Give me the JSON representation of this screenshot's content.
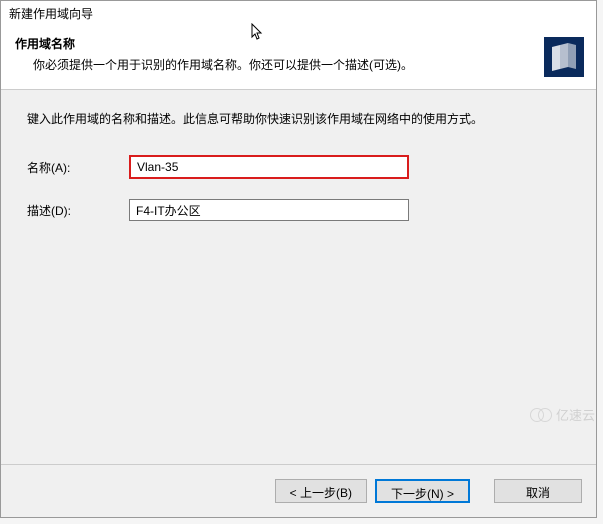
{
  "window": {
    "title": "新建作用域向导"
  },
  "header": {
    "title": "作用域名称",
    "subtitle": "你必须提供一个用于识别的作用域名称。你还可以提供一个描述(可选)。"
  },
  "content": {
    "instruction": "键入此作用域的名称和描述。此信息可帮助你快速识别该作用域在网络中的使用方式。",
    "name_label": "名称(A):",
    "name_value": "Vlan-35",
    "desc_label": "描述(D):",
    "desc_value": "F4-IT办公区"
  },
  "buttons": {
    "back": "< 上一步(B)",
    "next": "下一步(N) >",
    "cancel": "取消"
  },
  "watermark": "亿速云"
}
